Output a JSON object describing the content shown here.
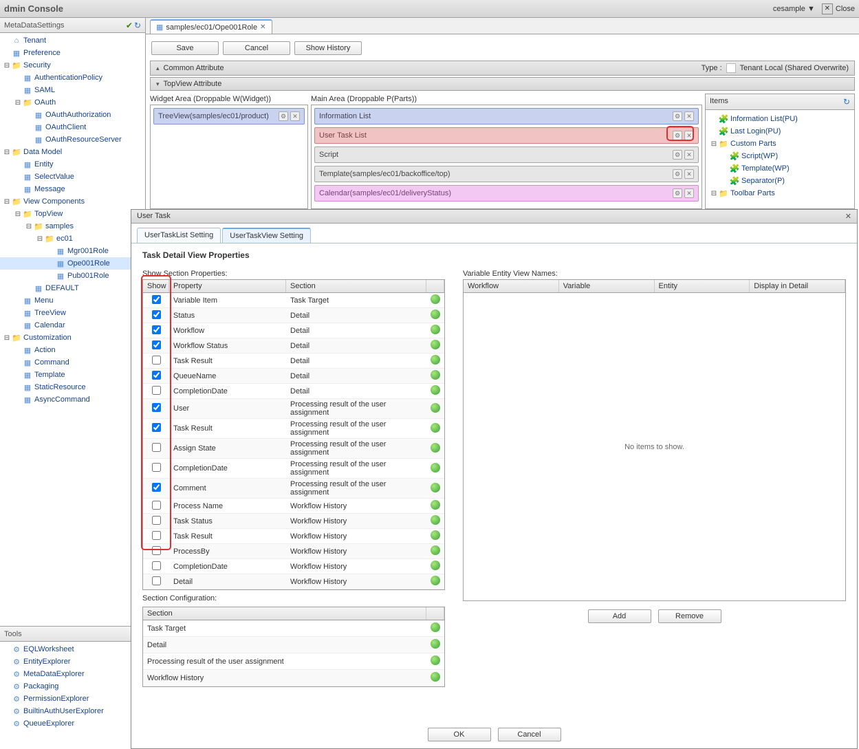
{
  "topbar": {
    "title": "dmin Console",
    "user": "cesample",
    "close": "Close"
  },
  "sidebar": {
    "title": "MetaDataSettings",
    "tree": [
      {
        "ind": 0,
        "tog": "",
        "ic": "home",
        "label": "Tenant"
      },
      {
        "ind": 0,
        "tog": "",
        "ic": "leaf",
        "label": "Preference"
      },
      {
        "ind": 0,
        "tog": "⊟",
        "ic": "folder",
        "label": "Security"
      },
      {
        "ind": 1,
        "tog": "",
        "ic": "leaf",
        "label": "AuthenticationPolicy"
      },
      {
        "ind": 1,
        "tog": "",
        "ic": "leaf",
        "label": "SAML"
      },
      {
        "ind": 1,
        "tog": "⊟",
        "ic": "folder",
        "label": "OAuth"
      },
      {
        "ind": 2,
        "tog": "",
        "ic": "leaf",
        "label": "OAuthAuthorization"
      },
      {
        "ind": 2,
        "tog": "",
        "ic": "leaf",
        "label": "OAuthClient"
      },
      {
        "ind": 2,
        "tog": "",
        "ic": "leaf",
        "label": "OAuthResourceServer"
      },
      {
        "ind": 0,
        "tog": "⊟",
        "ic": "folder",
        "label": "Data Model"
      },
      {
        "ind": 1,
        "tog": "",
        "ic": "leaf",
        "label": "Entity"
      },
      {
        "ind": 1,
        "tog": "",
        "ic": "leaf",
        "label": "SelectValue"
      },
      {
        "ind": 1,
        "tog": "",
        "ic": "leaf",
        "label": "Message"
      },
      {
        "ind": 0,
        "tog": "⊟",
        "ic": "folder",
        "label": "View Components"
      },
      {
        "ind": 1,
        "tog": "⊟",
        "ic": "folder",
        "label": "TopView"
      },
      {
        "ind": 2,
        "tog": "⊟",
        "ic": "folder",
        "label": "samples"
      },
      {
        "ind": 3,
        "tog": "⊟",
        "ic": "folder",
        "label": "ec01"
      },
      {
        "ind": 4,
        "tog": "",
        "ic": "leaf",
        "label": "Mgr001Role"
      },
      {
        "ind": 4,
        "tog": "",
        "ic": "leaf",
        "label": "Ope001Role",
        "sel": true
      },
      {
        "ind": 4,
        "tog": "",
        "ic": "leaf",
        "label": "Pub001Role"
      },
      {
        "ind": 2,
        "tog": "",
        "ic": "leaf",
        "label": "DEFAULT"
      },
      {
        "ind": 1,
        "tog": "",
        "ic": "leaf",
        "label": "Menu"
      },
      {
        "ind": 1,
        "tog": "",
        "ic": "leaf",
        "label": "TreeView"
      },
      {
        "ind": 1,
        "tog": "",
        "ic": "leaf",
        "label": "Calendar"
      },
      {
        "ind": 0,
        "tog": "⊟",
        "ic": "folder",
        "label": "Customization"
      },
      {
        "ind": 1,
        "tog": "",
        "ic": "leaf",
        "label": "Action"
      },
      {
        "ind": 1,
        "tog": "",
        "ic": "leaf",
        "label": "Command"
      },
      {
        "ind": 1,
        "tog": "",
        "ic": "leaf",
        "label": "Template"
      },
      {
        "ind": 1,
        "tog": "",
        "ic": "leaf",
        "label": "StaticResource"
      },
      {
        "ind": 1,
        "tog": "",
        "ic": "leaf",
        "label": "AsyncCommand"
      }
    ]
  },
  "tools": {
    "title": "Tools",
    "items": [
      "EQLWorksheet",
      "EntityExplorer",
      "MetaDataExplorer",
      "Packaging",
      "PermissionExplorer",
      "BuiltinAuthUserExplorer",
      "QueueExplorer"
    ]
  },
  "tab": {
    "label": "samples/ec01/Ope001Role"
  },
  "buttons": {
    "save": "Save",
    "cancel": "Cancel",
    "history": "Show History"
  },
  "common": {
    "title": "Common Attribute",
    "typeLabel": "Type :",
    "typeValue": "Tenant Local (Shared Overwrite)"
  },
  "topview": {
    "title": "TopView Attribute"
  },
  "widgetArea": {
    "label": "Widget Area (Droppable W(Widget))",
    "item": "TreeView(samples/ec01/product)"
  },
  "mainArea": {
    "label": "Main Area (Droppable P(Parts))",
    "items": [
      {
        "cls": "b-blue",
        "label": "Information List"
      },
      {
        "cls": "b-red",
        "label": "User Task List"
      },
      {
        "cls": "b-gray",
        "label": "Script"
      },
      {
        "cls": "b-gray",
        "label": "Template(samples/ec01/backoffice/top)"
      },
      {
        "cls": "b-pink",
        "label": "Calendar(samples/ec01/deliveryStatus)"
      }
    ]
  },
  "items": {
    "title": "Items",
    "list": [
      {
        "ind": 0,
        "tog": "",
        "ic": "puzzle",
        "label": "Information List(PU)"
      },
      {
        "ind": 0,
        "tog": "",
        "ic": "puzzle",
        "label": "Last Login(PU)"
      },
      {
        "ind": 0,
        "tog": "⊟",
        "ic": "folder",
        "label": "Custom Parts"
      },
      {
        "ind": 1,
        "tog": "",
        "ic": "puzzle",
        "label": "Script(WP)"
      },
      {
        "ind": 1,
        "tog": "",
        "ic": "puzzle",
        "label": "Template(WP)"
      },
      {
        "ind": 1,
        "tog": "",
        "ic": "puzzle",
        "label": "Separator(P)"
      },
      {
        "ind": 0,
        "tog": "⊟",
        "ic": "folder",
        "label": "Toolbar Parts"
      }
    ]
  },
  "dialog": {
    "title": "User Task",
    "tabs": {
      "t1": "UserTaskList Setting",
      "t2": "UserTaskView Setting"
    },
    "heading": "Task Detail View Properties",
    "showLabel": "Show Section Properties:",
    "cols": {
      "show": "Show",
      "prop": "Property",
      "sec": "Section"
    },
    "rows": [
      {
        "c": true,
        "p": "Variable Item",
        "s": "Task Target"
      },
      {
        "c": true,
        "p": "Status",
        "s": "Detail"
      },
      {
        "c": true,
        "p": "Workflow",
        "s": "Detail"
      },
      {
        "c": true,
        "p": "Workflow Status",
        "s": "Detail"
      },
      {
        "c": false,
        "p": "Task Result",
        "s": "Detail"
      },
      {
        "c": true,
        "p": "QueueName",
        "s": "Detail"
      },
      {
        "c": false,
        "p": "CompletionDate",
        "s": "Detail"
      },
      {
        "c": true,
        "p": "User",
        "s": "Processing result of the user assignment"
      },
      {
        "c": true,
        "p": "Task Result",
        "s": "Processing result of the user assignment"
      },
      {
        "c": false,
        "p": "Assign State",
        "s": "Processing result of the user assignment"
      },
      {
        "c": false,
        "p": "CompletionDate",
        "s": "Processing result of the user assignment"
      },
      {
        "c": true,
        "p": "Comment",
        "s": "Processing result of the user assignment"
      },
      {
        "c": false,
        "p": "Process Name",
        "s": "Workflow History"
      },
      {
        "c": false,
        "p": "Task Status",
        "s": "Workflow History"
      },
      {
        "c": false,
        "p": "Task Result",
        "s": "Workflow History"
      },
      {
        "c": false,
        "p": "ProcessBy",
        "s": "Workflow History"
      },
      {
        "c": false,
        "p": "CompletionDate",
        "s": "Workflow History"
      },
      {
        "c": false,
        "p": "Detail",
        "s": "Workflow History"
      }
    ],
    "secCfgLabel": "Section Configuration:",
    "secHead": "Section",
    "secs": [
      "Task Target",
      "Detail",
      "Processing result of the user assignment",
      "Workflow History"
    ],
    "varLabel": "Variable Entity View Names:",
    "varCols": [
      "Workflow",
      "Variable",
      "Entity",
      "Display in Detail"
    ],
    "empty": "No items to show.",
    "add": "Add",
    "remove": "Remove",
    "ok": "OK",
    "cancel": "Cancel"
  }
}
